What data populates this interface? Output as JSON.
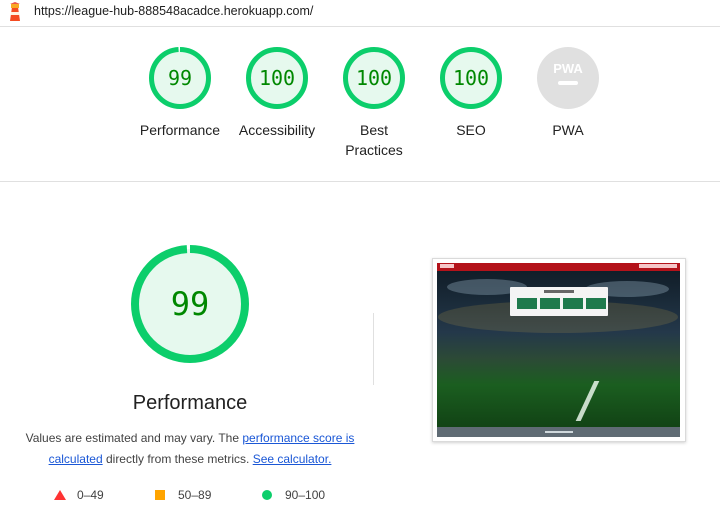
{
  "address_bar": {
    "url": "https://league-hub-888548acadce.herokuapp.com/",
    "logo_icon": "lighthouse-icon"
  },
  "colors": {
    "pass": "#0cce6b",
    "pass_text": "#008800",
    "pass_fill": "#e6f9ee",
    "average": "#ffa400",
    "fail": "#ff3333",
    "na_fill": "#e0e0e0",
    "link": "#1a57d6",
    "nav_red": "#b3121a"
  },
  "scores": [
    {
      "label": "Performance",
      "value": "99",
      "score": 0.99
    },
    {
      "label": "Accessibility",
      "value": "100",
      "score": 1.0
    },
    {
      "label": "Best Practices",
      "value": "100",
      "score": 1.0
    },
    {
      "label": "SEO",
      "value": "100",
      "score": 1.0
    }
  ],
  "pwa": {
    "label": "PWA",
    "badge_text": "PWA"
  },
  "performance": {
    "score": "99",
    "title": "Performance",
    "note_prefix": "Values are estimated and may vary. The ",
    "link_score": "performance score is calculated",
    "note_middle": " directly from these metrics. ",
    "link_calc": "See calculator."
  },
  "legend": [
    {
      "range": "0–49",
      "shape": "triangle",
      "color": "#ff3333"
    },
    {
      "range": "50–89",
      "shape": "square",
      "color": "#ffa400"
    },
    {
      "range": "90–100",
      "shape": "circle",
      "color": "#0cce6b"
    }
  ],
  "screenshot": {
    "alt": "final-screenshot-thumbnail"
  }
}
